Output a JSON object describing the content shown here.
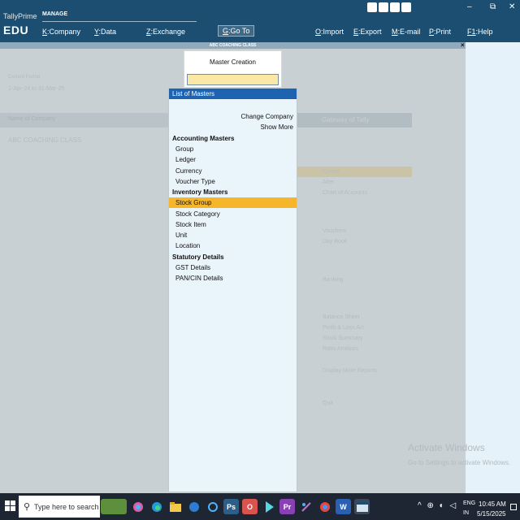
{
  "app": {
    "brand_small": "TallyPrime",
    "brand_edition": "EDU",
    "section_label": "MANAGE"
  },
  "menu": [
    {
      "key": "K",
      "label": ":Company"
    },
    {
      "key": "Y",
      "label": ":Data"
    },
    {
      "key": "Z",
      "label": ":Exchange"
    },
    {
      "key": "G",
      "label": ":Go To"
    },
    {
      "key": "O",
      "label": ":Import"
    },
    {
      "key": "E",
      "label": ":Export"
    },
    {
      "key": "M",
      "label": ":E-mail"
    },
    {
      "key": "P",
      "label": ":Print"
    },
    {
      "key": "F1",
      "label": ":Help"
    }
  ],
  "window_controls": {
    "minimize": "–",
    "restore": "⧉",
    "close": "✕"
  },
  "company_strip": "ABC COACHING CLASS",
  "background": {
    "period_label": "Current Period",
    "period_value": "1-Apr-24 to 31-Mar-25",
    "company_header": "Name of Company",
    "company_name": "ABC COACHING CLASS",
    "gateway_title": "Gateway of Tally",
    "gateway_items": [
      "Create",
      "Alter",
      "Chart of Accounts",
      "Vouchers",
      "Day Book",
      "Banking",
      "Balance Sheet",
      "Profit & Loss A/c",
      "Stock Summary",
      "Ratio Analysis",
      "Display More Reports",
      "Quit"
    ],
    "activate_line1": "Activate Windows",
    "activate_line2": "Go to Settings to activate Windows."
  },
  "master_creation": {
    "title": "Master Creation",
    "input_value": ""
  },
  "list_of_masters": {
    "title": "List of Masters",
    "change_company": "Change Company",
    "show_more": "Show More",
    "accounting": {
      "title": "Accounting Masters",
      "items": [
        "Group",
        "Ledger",
        "Currency",
        "Voucher Type"
      ]
    },
    "inventory": {
      "title": "Inventory Masters",
      "items": [
        "Stock Group",
        "Stock Category",
        "Stock Item",
        "Unit",
        "Location"
      ],
      "selected": "Stock Group"
    },
    "statutory": {
      "title": "Statutory Details",
      "items": [
        "GST Details",
        "PAN/CIN Details"
      ]
    }
  },
  "taskbar": {
    "search_placeholder": "Type here to search",
    "lang_top": "ENG",
    "lang_bottom": "IN",
    "time": "10:45 AM",
    "date": "5/15/2025",
    "tray_icons": "^ ⊕ ◐ ◁"
  }
}
